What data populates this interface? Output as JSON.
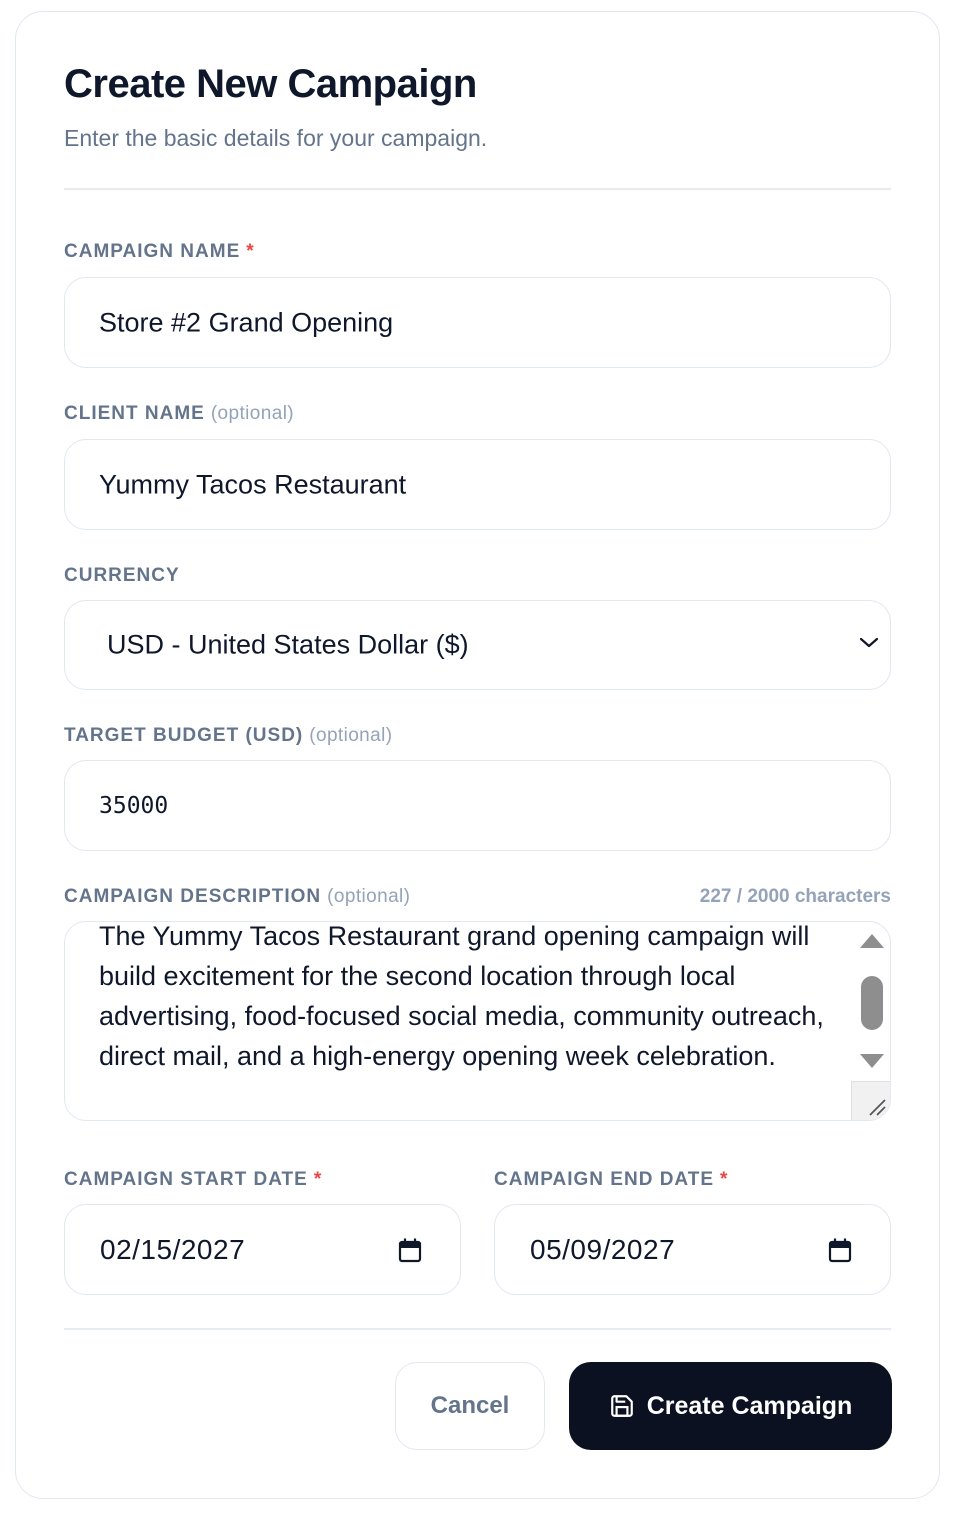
{
  "header": {
    "title": "Create New Campaign",
    "subtitle": "Enter the basic details for your campaign."
  },
  "fields": {
    "campaign_name": {
      "label": "CAMPAIGN NAME",
      "required_mark": "*",
      "value": "Store #2 Grand Opening"
    },
    "client_name": {
      "label": "CLIENT NAME",
      "optional": "(optional)",
      "value": "Yummy Tacos Restaurant"
    },
    "currency": {
      "label": "CURRENCY",
      "selected": "USD - United States Dollar ($)",
      "icon": "chevron-down-icon"
    },
    "target_budget": {
      "label": "TARGET BUDGET (USD)",
      "optional": "(optional)",
      "value": "35000"
    },
    "description": {
      "label": "CAMPAIGN DESCRIPTION",
      "optional": "(optional)",
      "counter": "227 / 2000 characters",
      "value": "The Yummy Tacos Restaurant grand opening campaign will build excitement for the second location through local advertising, food-focused social media, community outreach, direct mail, and a high-energy opening week celebration."
    },
    "start_date": {
      "label": "CAMPAIGN START DATE",
      "required_mark": "*",
      "value": "02/15/2027",
      "icon": "calendar-icon"
    },
    "end_date": {
      "label": "CAMPAIGN END DATE",
      "required_mark": "*",
      "value": "05/09/2027",
      "icon": "calendar-icon"
    }
  },
  "actions": {
    "cancel_label": "Cancel",
    "create_label": "Create Campaign",
    "create_icon": "save-icon"
  },
  "colors": {
    "primary_button": "#0b1120",
    "label": "#64748b",
    "required": "#ef4444",
    "border": "#e2e8f0"
  }
}
